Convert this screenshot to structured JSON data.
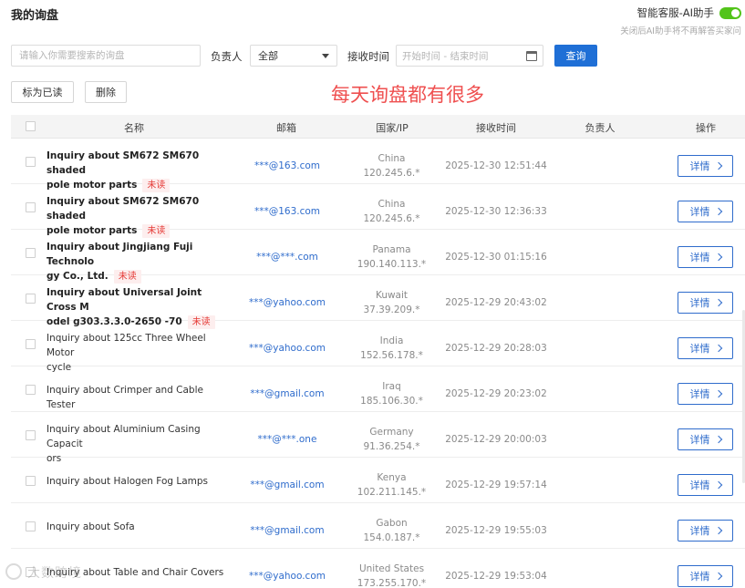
{
  "header": {
    "title": "我的询盘",
    "ai_label": "智能客服-AI助手",
    "ai_hint": "关闭后AI助手将不再解答买家问",
    "ai_enabled": true
  },
  "filters": {
    "search_placeholder": "请输入你需要搜索的询盘",
    "owner_label": "负责人",
    "owner_value": "全部",
    "time_label": "接收时间",
    "time_placeholder": "开始时间 - 结束时间",
    "query_button": "查询"
  },
  "actions": {
    "mark_read": "标为已读",
    "delete": "删除"
  },
  "overlay_text": "每天询盘都有很多",
  "table": {
    "columns": [
      "名称",
      "邮箱",
      "国家/IP",
      "接收时间",
      "负责人",
      "操作"
    ],
    "unread_label": "未读",
    "detail_label": "详情",
    "rows": [
      {
        "name_l1": "Inquiry about SM672 SM670 shaded",
        "name_l2": "pole motor parts",
        "unread": true,
        "email": "***@163.com",
        "country": "China",
        "ip": "120.245.6.*",
        "time": "2025-12-30 12:51:44",
        "owner": ""
      },
      {
        "name_l1": "Inquiry about SM672 SM670 shaded",
        "name_l2": "pole motor parts",
        "unread": true,
        "email": "***@163.com",
        "country": "China",
        "ip": "120.245.6.*",
        "time": "2025-12-30 12:36:33",
        "owner": ""
      },
      {
        "name_l1": "Inquiry about Jingjiang Fuji Technolo",
        "name_l2": "gy Co., Ltd.",
        "unread": true,
        "email": "***@***.com",
        "country": "Panama",
        "ip": "190.140.113.*",
        "time": "2025-12-30 01:15:16",
        "owner": ""
      },
      {
        "name_l1": "Inquiry about Universal Joint Cross M",
        "name_l2": "odel g303.3.3.0-2650 -70",
        "unread": true,
        "email": "***@yahoo.com",
        "country": "Kuwait",
        "ip": "37.39.209.*",
        "time": "2025-12-29 20:43:02",
        "owner": ""
      },
      {
        "name_l1": "Inquiry about 125cc Three Wheel Motor",
        "name_l2": "cycle",
        "unread": false,
        "email": "***@yahoo.com",
        "country": "India",
        "ip": "152.56.178.*",
        "time": "2025-12-29 20:28:03",
        "owner": ""
      },
      {
        "name_l1": "Inquiry about Crimper and Cable Tester",
        "name_l2": "",
        "unread": false,
        "email": "***@gmail.com",
        "country": "Iraq",
        "ip": "185.106.30.*",
        "time": "2025-12-29 20:23:02",
        "owner": ""
      },
      {
        "name_l1": "Inquiry about Aluminium Casing Capacit",
        "name_l2": "ors",
        "unread": false,
        "email": "***@***.one",
        "country": "Germany",
        "ip": "91.36.254.*",
        "time": "2025-12-29 20:00:03",
        "owner": ""
      },
      {
        "name_l1": "Inquiry about Halogen Fog Lamps",
        "name_l2": "",
        "unread": false,
        "email": "***@gmail.com",
        "country": "Kenya",
        "ip": "102.211.145.*",
        "time": "2025-12-29 19:57:14",
        "owner": ""
      },
      {
        "name_l1": "Inquiry about Sofa",
        "name_l2": "",
        "unread": false,
        "email": "***@gmail.com",
        "country": "Gabon",
        "ip": "154.0.187.*",
        "time": "2025-12-29 19:55:03",
        "owner": ""
      },
      {
        "name_l1": "Inquiry about Table and Chair Covers",
        "name_l2": "",
        "unread": false,
        "email": "***@yahoo.com",
        "country": "United States",
        "ip": "173.255.170.*",
        "time": "2025-12-29 19:53:04",
        "owner": ""
      }
    ]
  },
  "watermark": "大数跨境",
  "colors": {
    "primary": "#1f6fd6",
    "link": "#2f6ccc",
    "unread_text": "#e53935",
    "unread_bg": "#fdeeee",
    "toggle_on": "#52c41a",
    "overlay": "#ef4f4f"
  }
}
